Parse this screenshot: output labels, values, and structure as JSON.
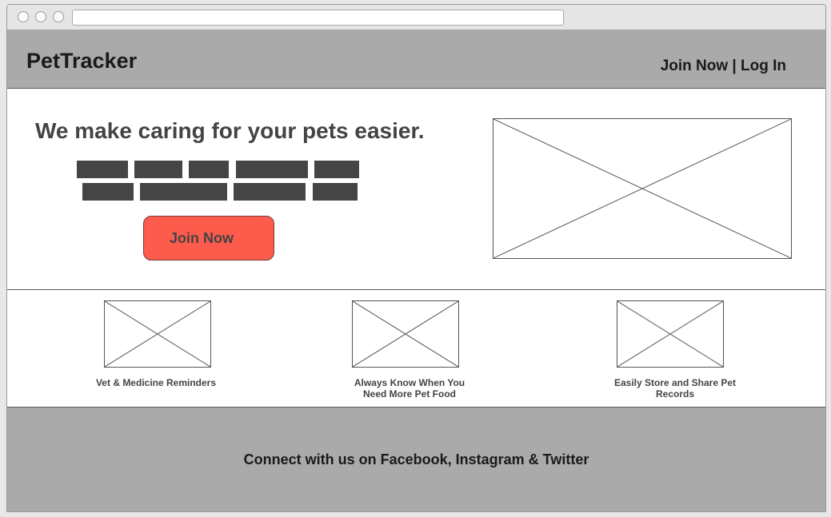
{
  "header": {
    "logo": "PetTracker",
    "join_label": "Join Now",
    "separator": " | ",
    "login_label": "Log In"
  },
  "hero": {
    "headline": "We make caring for your pets easier.",
    "cta_label": "Join Now"
  },
  "features": [
    {
      "caption": "Vet & Medicine Reminders"
    },
    {
      "caption": "Always Know When You Need More Pet Food"
    },
    {
      "caption": "Easily Store and Share Pet Records"
    }
  ],
  "footer": {
    "text": "Connect with us on Facebook, Instagram & Twitter"
  }
}
